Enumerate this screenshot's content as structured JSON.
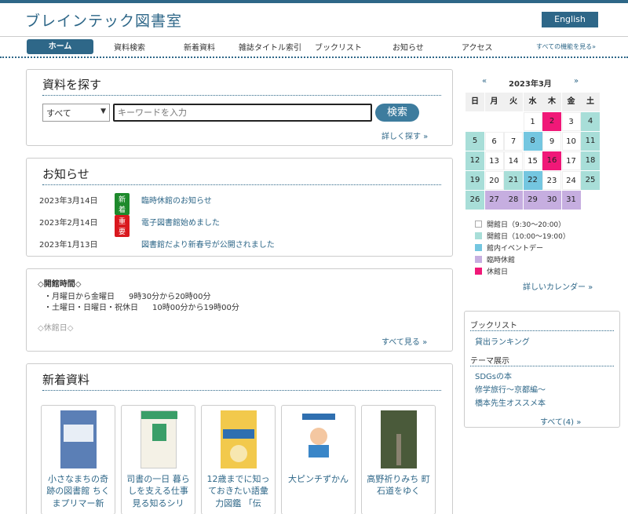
{
  "header": {
    "site_title": "ブレインテック図書室",
    "english_label": "English"
  },
  "nav": {
    "items": [
      "ホーム",
      "資料検索",
      "新着資料",
      "雑誌タイトル索引",
      "ブックリスト",
      "お知らせ",
      "アクセス"
    ],
    "all_features": "すべての機能を見る»"
  },
  "search": {
    "title": "資料を探す",
    "select_value": "すべて",
    "placeholder": "キーワードを入力",
    "button": "検索",
    "detail_link": "詳しく探す »"
  },
  "news": {
    "title": "お知らせ",
    "items": [
      {
        "date": "2023年3月14日",
        "badge": "新着",
        "badge_color": "#1e8a2c",
        "text": "臨時休館のお知らせ"
      },
      {
        "date": "2023年2月14日",
        "badge": "重要",
        "badge_color": "#d9181e",
        "text": "電子図書館始めました"
      },
      {
        "date": "2023年1月13日",
        "badge": "",
        "badge_color": "",
        "text": "図書館だより新春号が公開されました"
      }
    ]
  },
  "hours": {
    "title": "◇開館時間◇",
    "lines": [
      {
        "days": "・月曜日から金曜日",
        "time": "9時30分から20時00分"
      },
      {
        "days": "・土曜日・日曜日・祝休日",
        "time": "10時00分から19時00分"
      }
    ],
    "closed": "◇休館日◇",
    "see_all": "すべて見る »"
  },
  "new_items": {
    "title": "新着資料",
    "books": [
      {
        "title": "小さなまちの奇跡の図書館 ちくまプリマー新",
        "cover_color": "#5b7fb6"
      },
      {
        "title": "司書の一日 暮らしを支える仕事見る知るシリ",
        "cover_color": "#3a9e68"
      },
      {
        "title": "12歳までに知っておきたい語彙力図鑑 「伝",
        "cover_color": "#f2c94c"
      },
      {
        "title": "大ピンチずかん",
        "cover_color": "#ffffff"
      },
      {
        "title": "高野祈りみち 町石道をゆく",
        "cover_color": "#4a5a3a"
      }
    ]
  },
  "calendar": {
    "prev": "«",
    "next": "»",
    "month_label": "2023年3月",
    "weekdays": [
      "日",
      "月",
      "火",
      "水",
      "木",
      "金",
      "土"
    ],
    "colors": {
      "open_short": "#ffffff",
      "open_long": "#a8ded8",
      "event": "#74c6e0",
      "temp_closed": "#c6aee0",
      "closed": "#f01878"
    },
    "weeks": [
      [
        {
          "d": "",
          "t": "blank"
        },
        {
          "d": "",
          "t": "blank"
        },
        {
          "d": "",
          "t": "blank"
        },
        {
          "d": "1",
          "t": "open_short"
        },
        {
          "d": "2",
          "t": "closed"
        },
        {
          "d": "3",
          "t": "open_short"
        },
        {
          "d": "4",
          "t": "open_long"
        }
      ],
      [
        {
          "d": "5",
          "t": "open_long"
        },
        {
          "d": "6",
          "t": "open_short"
        },
        {
          "d": "7",
          "t": "open_short"
        },
        {
          "d": "8",
          "t": "event"
        },
        {
          "d": "9",
          "t": "open_short"
        },
        {
          "d": "10",
          "t": "open_short"
        },
        {
          "d": "11",
          "t": "open_long"
        }
      ],
      [
        {
          "d": "12",
          "t": "open_long"
        },
        {
          "d": "13",
          "t": "open_short"
        },
        {
          "d": "14",
          "t": "open_short"
        },
        {
          "d": "15",
          "t": "open_short"
        },
        {
          "d": "16",
          "t": "closed"
        },
        {
          "d": "17",
          "t": "open_short"
        },
        {
          "d": "18",
          "t": "open_long"
        }
      ],
      [
        {
          "d": "19",
          "t": "open_long"
        },
        {
          "d": "20",
          "t": "open_short"
        },
        {
          "d": "21",
          "t": "open_long"
        },
        {
          "d": "22",
          "t": "event"
        },
        {
          "d": "23",
          "t": "open_short"
        },
        {
          "d": "24",
          "t": "open_short"
        },
        {
          "d": "25",
          "t": "open_long"
        }
      ],
      [
        {
          "d": "26",
          "t": "open_long"
        },
        {
          "d": "27",
          "t": "temp_closed"
        },
        {
          "d": "28",
          "t": "temp_closed"
        },
        {
          "d": "29",
          "t": "temp_closed"
        },
        {
          "d": "30",
          "t": "temp_closed"
        },
        {
          "d": "31",
          "t": "temp_closed"
        },
        {
          "d": "",
          "t": "blank"
        }
      ]
    ],
    "legend": [
      {
        "label": "開館日（9:30～20:00）",
        "t": "open_short"
      },
      {
        "label": "開館日（10:00～19:00）",
        "t": "open_long"
      },
      {
        "label": "館内イベントデー",
        "t": "event"
      },
      {
        "label": "臨時休館",
        "t": "temp_closed"
      },
      {
        "label": "休館日",
        "t": "closed"
      }
    ],
    "more_link": "詳しいカレンダー »"
  },
  "sidebar": {
    "booklist_heading": "ブックリスト",
    "booklist_items": [
      "貸出ランキング"
    ],
    "theme_heading": "テーマ展示",
    "theme_items": [
      "SDGsの本",
      "修学旅行～京都編～",
      "橋本先生オススメ本"
    ],
    "all_link": "すべて(4) »"
  }
}
